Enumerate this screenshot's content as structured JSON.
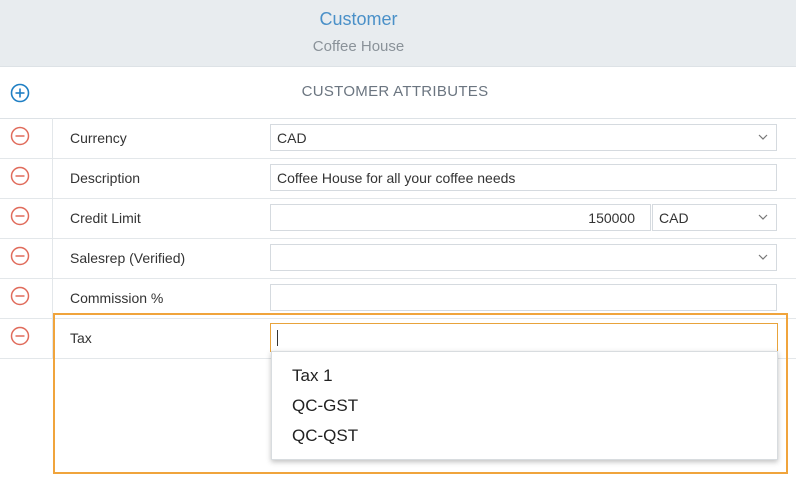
{
  "header": {
    "title": "Customer",
    "subtitle": "Coffee House"
  },
  "section": {
    "title": "CUSTOMER ATTRIBUTES",
    "add_icon": "plus-circle-icon"
  },
  "attributes": [
    {
      "label": "Currency",
      "value": "CAD",
      "type": "select"
    },
    {
      "label": "Description",
      "value": "Coffee House for all your coffee needs",
      "type": "text"
    },
    {
      "label": "Credit Limit",
      "amount": "150000",
      "currency": "CAD",
      "type": "money"
    },
    {
      "label": "Salesrep (Verified)",
      "value": "",
      "type": "select"
    },
    {
      "label": "Commission %",
      "value": "",
      "type": "text"
    },
    {
      "label": "Tax",
      "value": "",
      "type": "autocomplete"
    }
  ],
  "tax_dropdown": {
    "options": [
      "Tax 1",
      "QC-GST",
      "QC-QST"
    ]
  },
  "colors": {
    "accent": "#4a90c8",
    "remove": "#e06b5b",
    "highlight": "#f0a43c",
    "focus_border": "#e8a33b"
  }
}
